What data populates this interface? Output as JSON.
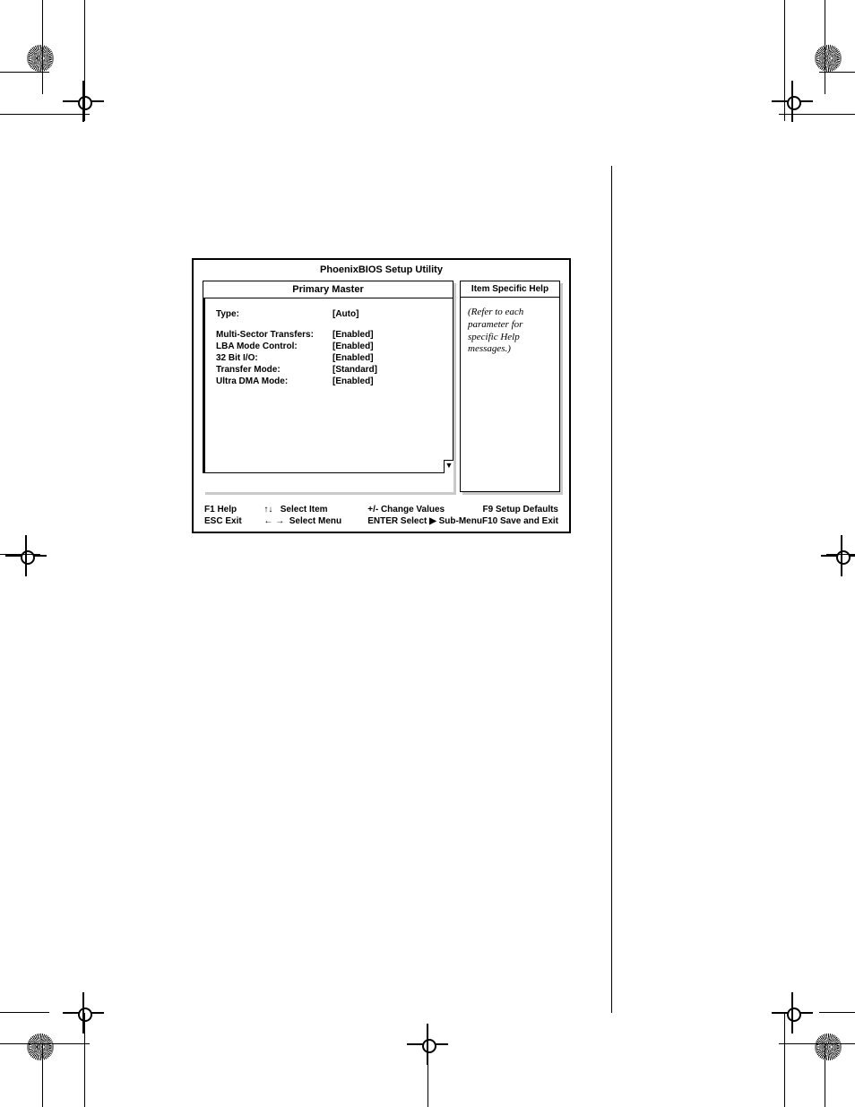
{
  "bios": {
    "title": "PhoenixBIOS Setup Utility",
    "panel_title": "Primary Master",
    "help_title": "Item Specific Help",
    "help_text": "(Refer to each parameter for specific Help messages.)",
    "rows": [
      {
        "label": "Type:",
        "value": "[Auto]"
      },
      {
        "label": "Multi-Sector Transfers:",
        "value": "[Enabled]"
      },
      {
        "label": "LBA Mode Control:",
        "value": "[Enabled]"
      },
      {
        "label": "32 Bit I/O:",
        "value": "[Enabled]"
      },
      {
        "label": "Transfer Mode:",
        "value": "[Standard]"
      },
      {
        "label": "Ultra DMA Mode:",
        "value": "[Enabled]"
      }
    ],
    "legend": {
      "f1": "F1 Help",
      "esc": "ESC Exit",
      "select_item": "Select Item",
      "select_menu": "Select Menu",
      "change_values": "+/- Change Values",
      "enter_submenu": "ENTER Select ▶ Sub-Menu",
      "f9": "F9 Setup Defaults",
      "f10": "F10 Save and Exit",
      "arrows_ud": "↑↓",
      "arrows_lr": "← →"
    },
    "scroll_marker": "▼"
  }
}
